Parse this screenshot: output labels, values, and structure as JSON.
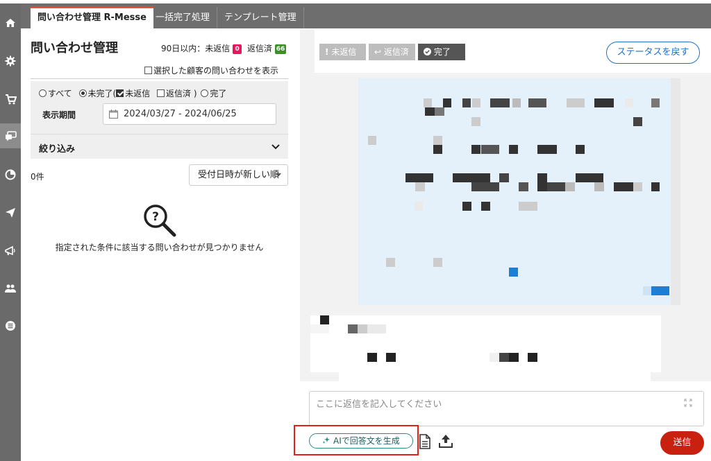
{
  "tabs": [
    {
      "label": "問い合わせ管理 R-Messe",
      "active": true
    },
    {
      "label": "一括完了処理",
      "active": false
    },
    {
      "label": "テンプレート管理",
      "active": false
    }
  ],
  "sidebar_icons": [
    "home-icon",
    "gear-icon",
    "cart-icon",
    "chat-icon",
    "pie-chart-icon",
    "send-icon",
    "megaphone-icon",
    "users-icon",
    "list-icon"
  ],
  "left_panel": {
    "title": "問い合わせ管理",
    "period_prefix": "90日以内：未返信",
    "unreplied_count": "0",
    "replied_label": "返信済",
    "replied_count": "66",
    "show_selected_label": "選択した顧客の問い合わせを表示",
    "filter": {
      "all_label": "すべて",
      "incomplete_label": "未完了(",
      "unreplied_label": "未返信",
      "replied_label": "返信済 )",
      "complete_label": "完了",
      "period_label": "表示期間",
      "date_range": "2024/03/27 - 2024/06/25",
      "narrow_label": "絞り込み"
    },
    "result_count": "0件",
    "sort_selected": "受付日時が新しい順",
    "empty_message": "指定された条件に該当する問い合わせが見つかりません"
  },
  "toolbar": {
    "unreplied_btn": "未返信",
    "replied_btn": "返信済",
    "complete_btn": "完了",
    "revert_status_btn": "ステータスを戻す"
  },
  "reply": {
    "placeholder": "ここに返信を記入してください",
    "ai_button": "AIで回答文を生成",
    "send_button": "送信"
  },
  "colors": {
    "unreplied_badge": "#e8175d",
    "replied_badge": "#3d8f2a",
    "accent_blue": "#1a72c7",
    "send_red": "#c8210f",
    "highlight_red": "#e2211c"
  }
}
